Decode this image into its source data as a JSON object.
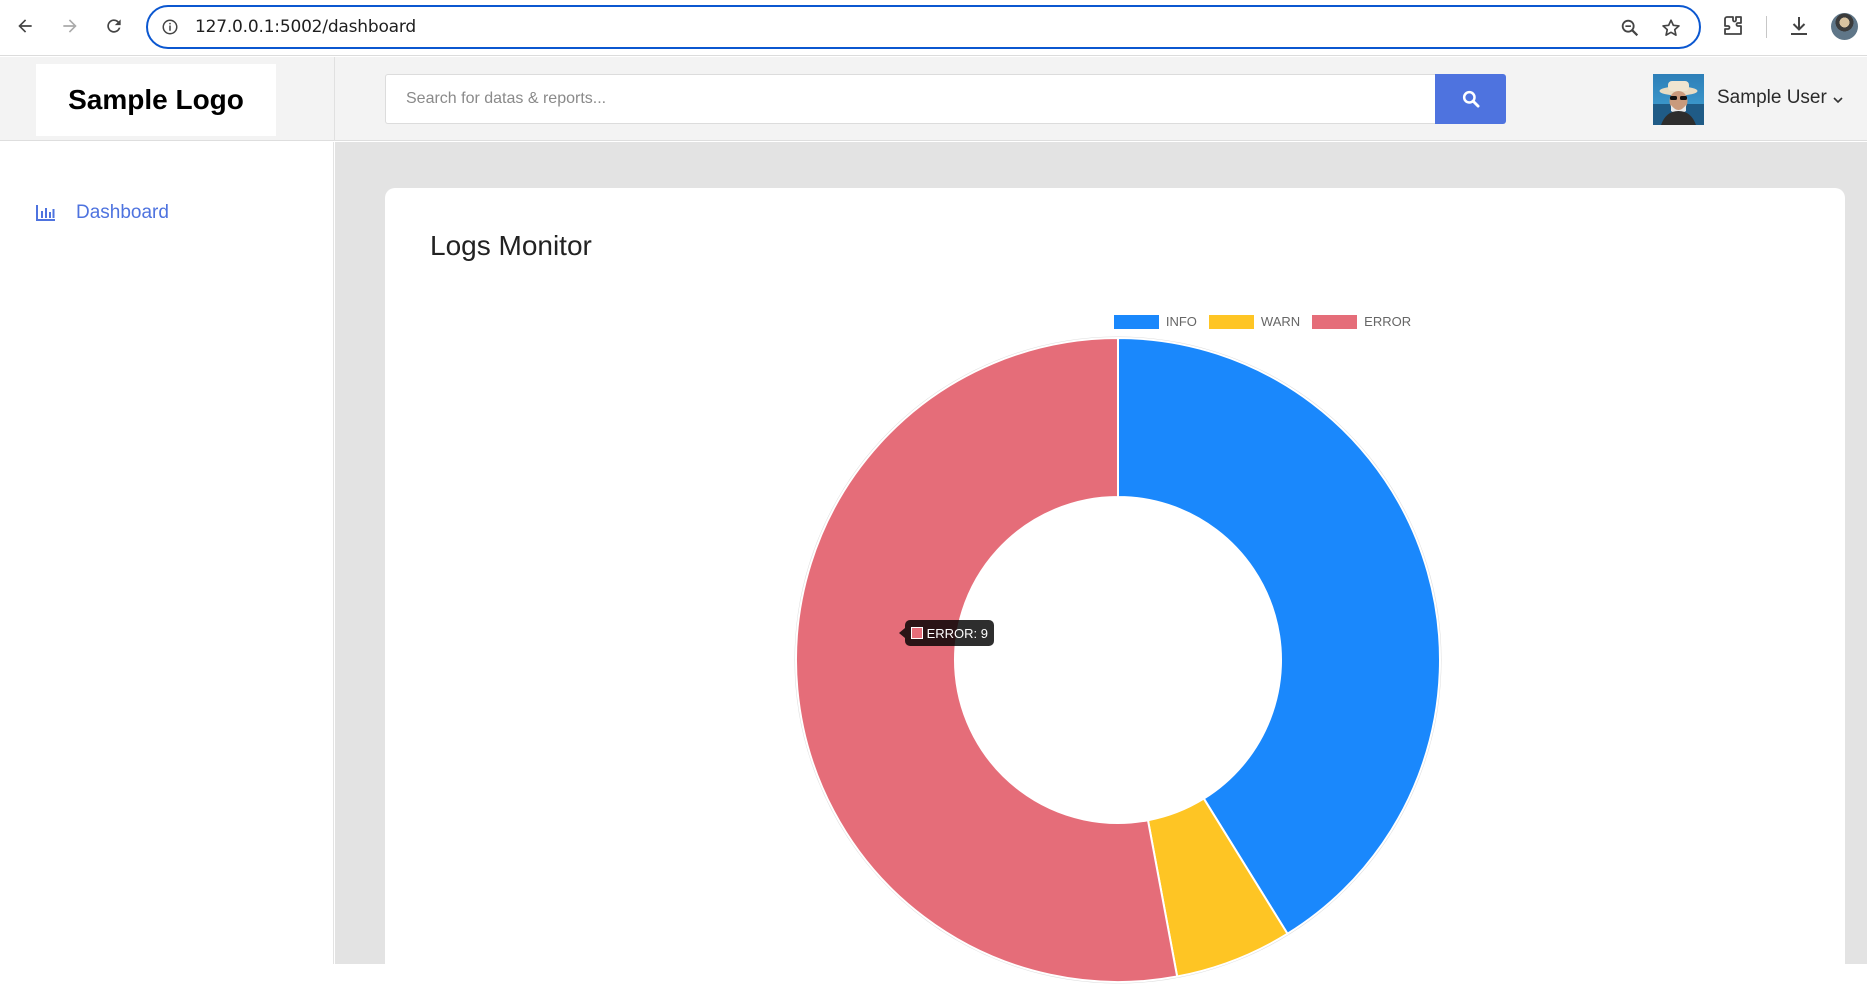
{
  "browser": {
    "url": "127.0.0.1:5002/dashboard",
    "icons": [
      "back-icon",
      "forward-icon",
      "reload-icon",
      "info-icon",
      "zoom-icon",
      "star-icon",
      "extensions-icon",
      "download-icon",
      "profile-icon"
    ]
  },
  "header": {
    "logo_text": "Sample Logo",
    "search_placeholder": "Search for datas & reports...",
    "user_name": "Sample User"
  },
  "sidebar": {
    "items": [
      {
        "label": "Dashboard",
        "icon": "bar-chart-icon",
        "active": true
      }
    ]
  },
  "main": {
    "title": "Logs Monitor"
  },
  "chart_data": {
    "type": "doughnut",
    "title": "",
    "legend_position": "top",
    "series": [
      {
        "name": "INFO",
        "value": 7,
        "color": "#1a88fc"
      },
      {
        "name": "WARN",
        "value": 1,
        "color": "#fec524"
      },
      {
        "name": "ERROR",
        "value": 9,
        "color": "#e56d79"
      }
    ],
    "tooltip": {
      "label": "ERROR",
      "value": 9,
      "text": "ERROR: 9",
      "color": "#e56d79"
    }
  },
  "colors": {
    "accent": "#4e73df",
    "info": "#1a88fc",
    "warn": "#fec524",
    "error": "#e56d79"
  }
}
